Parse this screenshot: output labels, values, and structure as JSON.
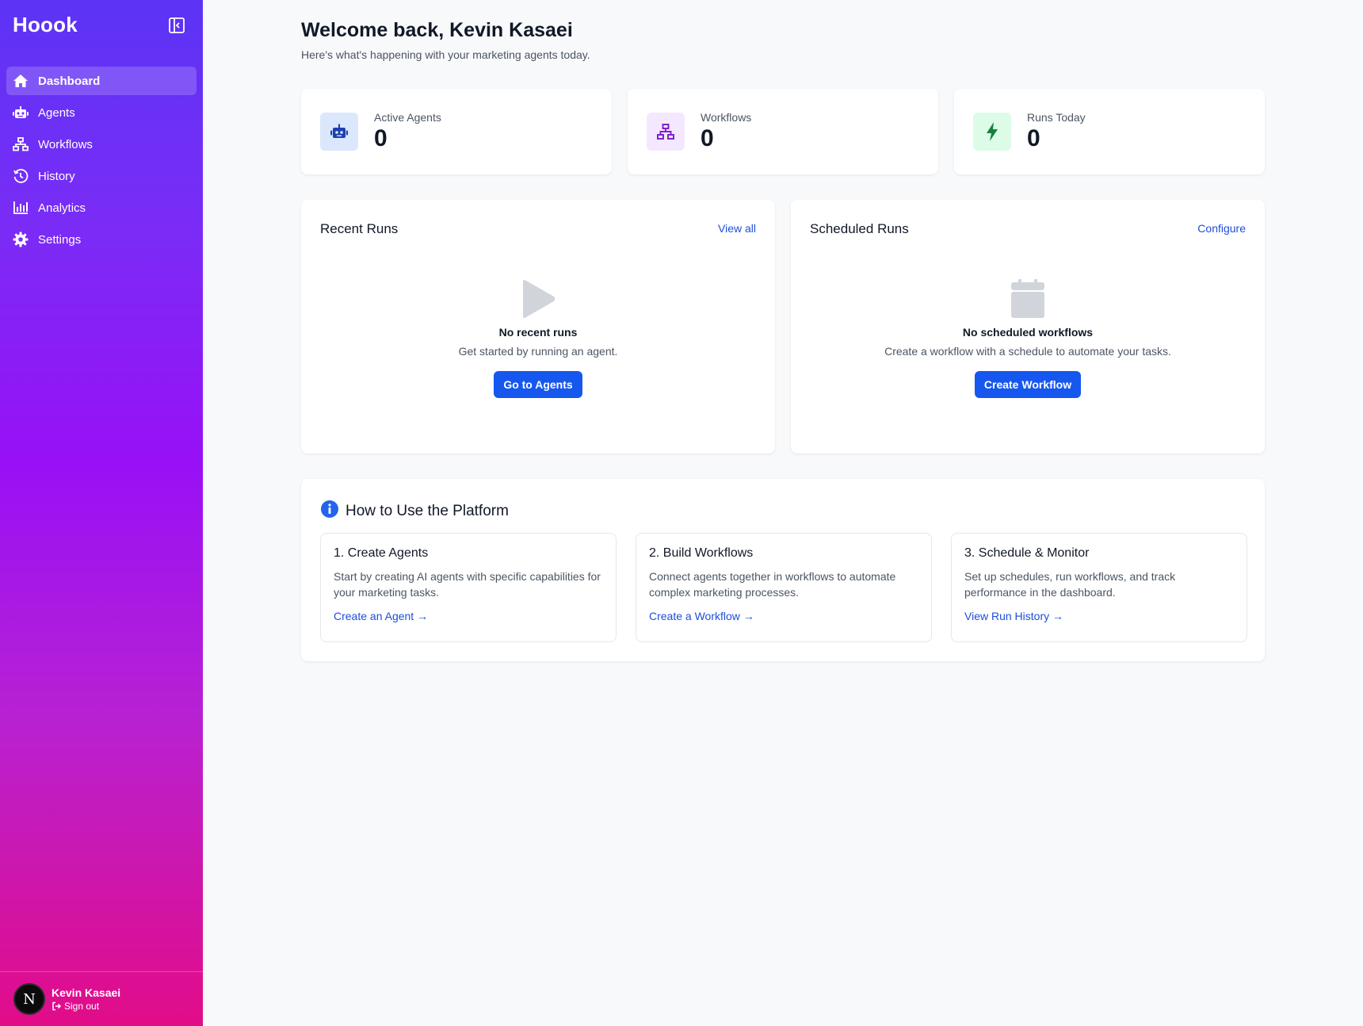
{
  "app": {
    "brand": "Hoook"
  },
  "colors": {
    "accent": "#1657f0",
    "link": "#1d4ed8",
    "sidebar_top": "#5b34f5",
    "sidebar_bottom": "#e20c88"
  },
  "sidebar": {
    "items": [
      {
        "label": "Dashboard",
        "icon": "home-icon",
        "active": true
      },
      {
        "label": "Agents",
        "icon": "robot-icon",
        "active": false
      },
      {
        "label": "Workflows",
        "icon": "sitemap-icon",
        "active": false
      },
      {
        "label": "History",
        "icon": "history-icon",
        "active": false
      },
      {
        "label": "Analytics",
        "icon": "bar-chart-icon",
        "active": false
      },
      {
        "label": "Settings",
        "icon": "gear-icon",
        "active": false
      }
    ],
    "user": {
      "initial": "N",
      "name": "Kevin Kasaei",
      "sign_out": "Sign out"
    }
  },
  "header": {
    "title": "Welcome back, Kevin Kasaei",
    "subtitle": "Here's what's happening with your marketing agents today."
  },
  "stats": [
    {
      "label": "Active Agents",
      "value": "0",
      "icon": "robot-icon"
    },
    {
      "label": "Workflows",
      "value": "0",
      "icon": "sitemap-icon"
    },
    {
      "label": "Runs Today",
      "value": "0",
      "icon": "bolt-icon"
    }
  ],
  "recent_runs": {
    "title": "Recent Runs",
    "link": "View all",
    "empty_title": "No recent runs",
    "empty_sub": "Get started by running an agent.",
    "button": "Go to Agents"
  },
  "scheduled_runs": {
    "title": "Scheduled Runs",
    "link": "Configure",
    "empty_title": "No scheduled workflows",
    "empty_sub": "Create a workflow with a schedule to automate your tasks.",
    "button": "Create Workflow"
  },
  "guide": {
    "title": "How to Use the Platform",
    "steps": [
      {
        "title": "1. Create Agents",
        "desc": "Start by creating AI agents with specific capabilities for your marketing tasks.",
        "link": "Create an Agent →"
      },
      {
        "title": "2. Build Workflows",
        "desc": "Connect agents together in workflows to automate complex marketing processes.",
        "link": "Create a Workflow →"
      },
      {
        "title": "3. Schedule & Monitor",
        "desc": "Set up schedules, run workflows, and track performance in the dashboard.",
        "link": "View Run History →"
      }
    ]
  }
}
